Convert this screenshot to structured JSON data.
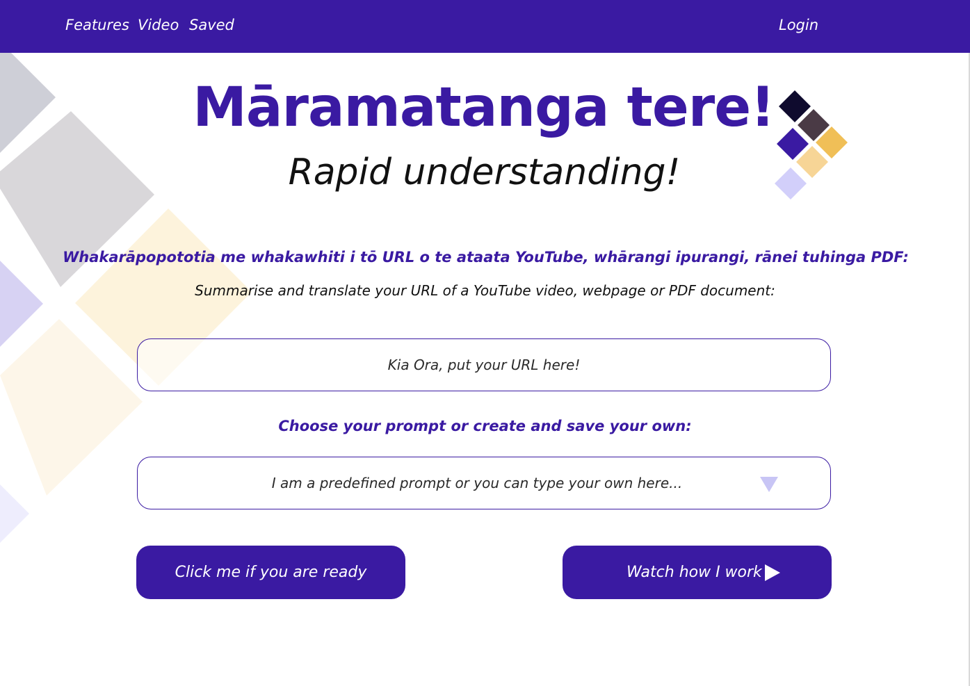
{
  "nav": {
    "links": [
      "Features",
      "Video",
      "Saved"
    ],
    "login": "Login"
  },
  "hero": {
    "title": "Māramatanga tere!",
    "subtitle": "Rapid understanding!"
  },
  "intro": {
    "maori": "Whakarāpopototia me whakawhiti i tō URL o te ataata YouTube, whārangi ipurangi, rānei tuhinga PDF:",
    "english": "Summarise and translate your URL of a YouTube video, webpage or PDF document:"
  },
  "url_input": {
    "placeholder": "Kia Ora, put your URL here!",
    "value": ""
  },
  "prompt": {
    "label": "Choose your prompt or create and save your own:",
    "placeholder": "I am a predefined prompt or you can type your own here...",
    "value": ""
  },
  "buttons": {
    "ready": "Click me if you are ready",
    "watch": "Watch how I work"
  },
  "icons": {
    "dropdown": "chevron-down-icon",
    "play": "play-icon",
    "logo": "diamond-mosaic-logo"
  },
  "colors": {
    "primary": "#3a1aa2",
    "background": "#ffffff",
    "logo_navy": "#0f0b2e",
    "logo_brown": "#4a3a45",
    "logo_gold": "#f0bf57",
    "logo_peach": "#f7d596",
    "logo_lavender": "#d2cffa"
  }
}
